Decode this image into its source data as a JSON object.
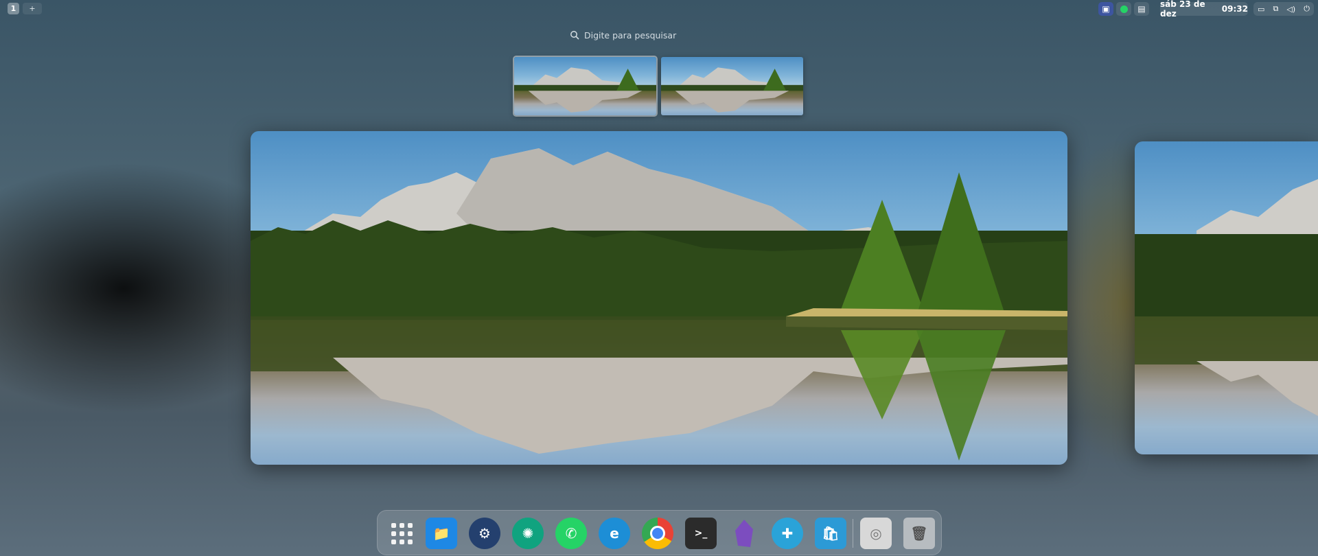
{
  "topbar": {
    "workspace_active": "1",
    "workspace_add": "+",
    "tray_icons": [
      "screen-icon",
      "whatsapp-icon",
      "clipboard-icon"
    ],
    "date": "sáb 23 de dez",
    "time": "09:32",
    "system_icons": [
      "display-icon",
      "network-icon",
      "volume-icon",
      "power-icon"
    ]
  },
  "search": {
    "placeholder": "Digite para pesquisar"
  },
  "workspaces": [
    {
      "label": "workspace-1",
      "active": true
    },
    {
      "label": "workspace-2",
      "active": false
    }
  ],
  "dock": {
    "apps": [
      {
        "name": "app-grid",
        "color": "transparent"
      },
      {
        "name": "files",
        "color": "#1e88e5"
      },
      {
        "name": "settings",
        "color": "#24406e"
      },
      {
        "name": "chatgpt",
        "color": "#10a37f"
      },
      {
        "name": "whatsapp",
        "color": "#25d366"
      },
      {
        "name": "edge",
        "color": "#1d8ed6"
      },
      {
        "name": "chrome",
        "color": "#e94235"
      },
      {
        "name": "terminal",
        "color": "#2b2b2b"
      },
      {
        "name": "obsidian",
        "color": "#7c4dbf"
      },
      {
        "name": "extensions",
        "color": "#2aa3d8"
      },
      {
        "name": "software",
        "color": "#2c9ad6"
      },
      {
        "name": "drive",
        "color": "#d8d8d8"
      },
      {
        "name": "trash",
        "color": "#b7bcc0"
      }
    ]
  }
}
